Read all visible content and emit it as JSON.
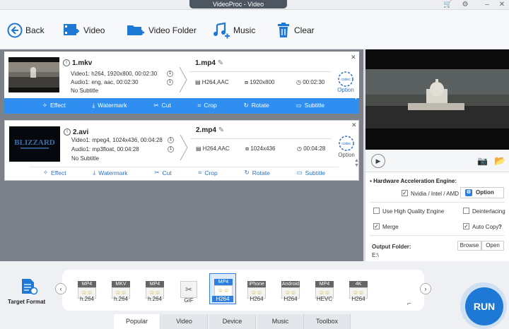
{
  "app": {
    "title": "VideoProc - Video"
  },
  "toolbar": {
    "back": "Back",
    "video": "Video",
    "video_folder": "Video Folder",
    "music": "Music",
    "clear": "Clear"
  },
  "items": [
    {
      "input_name": "1.mkv",
      "video_info": "Video1: h264, 1920x800, 00:02:30",
      "audio_info": "Audio1: eng, aac, 00:02:30",
      "subtitle": "No Subtitle",
      "video_stream": "1",
      "audio_stream": "1",
      "output_name": "1.mp4",
      "codec": "H264,AAC",
      "resolution": "1920x800",
      "duration": "00:02:30",
      "option": "Option",
      "selected": true
    },
    {
      "input_name": "2.avi",
      "video_info": "Video1: mpeg4, 1024x436, 00:04:28",
      "audio_info": "Audio1: mp3float, 00:04:28",
      "subtitle": "No Subtitle",
      "video_stream": "1",
      "audio_stream": "1",
      "output_name": "2.mp4",
      "codec": "H264,AAC",
      "resolution": "1024x436",
      "duration": "00:04:28",
      "option": "Option",
      "selected": false
    }
  ],
  "actions": {
    "effect": "Effect",
    "watermark": "Watermark",
    "cut": "Cut",
    "crop": "Crop",
    "rotate": "Rotate",
    "subtitle": "Subtitle"
  },
  "settings": {
    "hw_title": "Hardware Acceleration Engine:",
    "hw_vendor": "Nvidia / Intel / AMD",
    "option_button": "Option",
    "high_quality": "Use High Quality Engine",
    "deinterlacing": "Deinterlacing",
    "merge": "Merge",
    "auto_copy": "Auto Copy",
    "auto_copy_help": "?",
    "output_folder_label": "Output Folder:",
    "browse": "Browse",
    "open": "Open",
    "output_path": "E:\\"
  },
  "target_format": {
    "label": "Target Format"
  },
  "formats": [
    {
      "top": "MP4",
      "bottom": "h.264",
      "selected": false
    },
    {
      "top": "MKV",
      "bottom": "h.264",
      "selected": false
    },
    {
      "top": "MP4",
      "bottom": "h.264",
      "selected": false
    },
    {
      "top": "",
      "bottom": "GIF",
      "selected": false
    },
    {
      "top": "MP4",
      "bottom": "H264",
      "selected": true
    },
    {
      "top": "iPhone",
      "bottom": "H264",
      "selected": false
    },
    {
      "top": "Android",
      "bottom": "H264",
      "selected": false
    },
    {
      "top": "MP4",
      "bottom": "HEVC",
      "selected": false
    },
    {
      "top": "4K",
      "bottom": "H264",
      "selected": false
    }
  ],
  "tabs": [
    {
      "label": "Popular",
      "active": true
    },
    {
      "label": "Video",
      "active": false
    },
    {
      "label": "Device",
      "active": false
    },
    {
      "label": "Music",
      "active": false
    },
    {
      "label": "Toolbox",
      "active": false
    }
  ],
  "run": {
    "label": "RUN"
  },
  "colors": {
    "accent": "#2f8ef0",
    "run": "#1e79d6"
  },
  "icons": [
    "back-icon",
    "video-add-icon",
    "folder-add-icon",
    "music-add-icon",
    "trash-icon",
    "cart-icon",
    "gear-icon",
    "minimize-icon",
    "close-icon",
    "play-icon",
    "snapshot-icon",
    "folder-icon",
    "codec-gear-icon"
  ]
}
